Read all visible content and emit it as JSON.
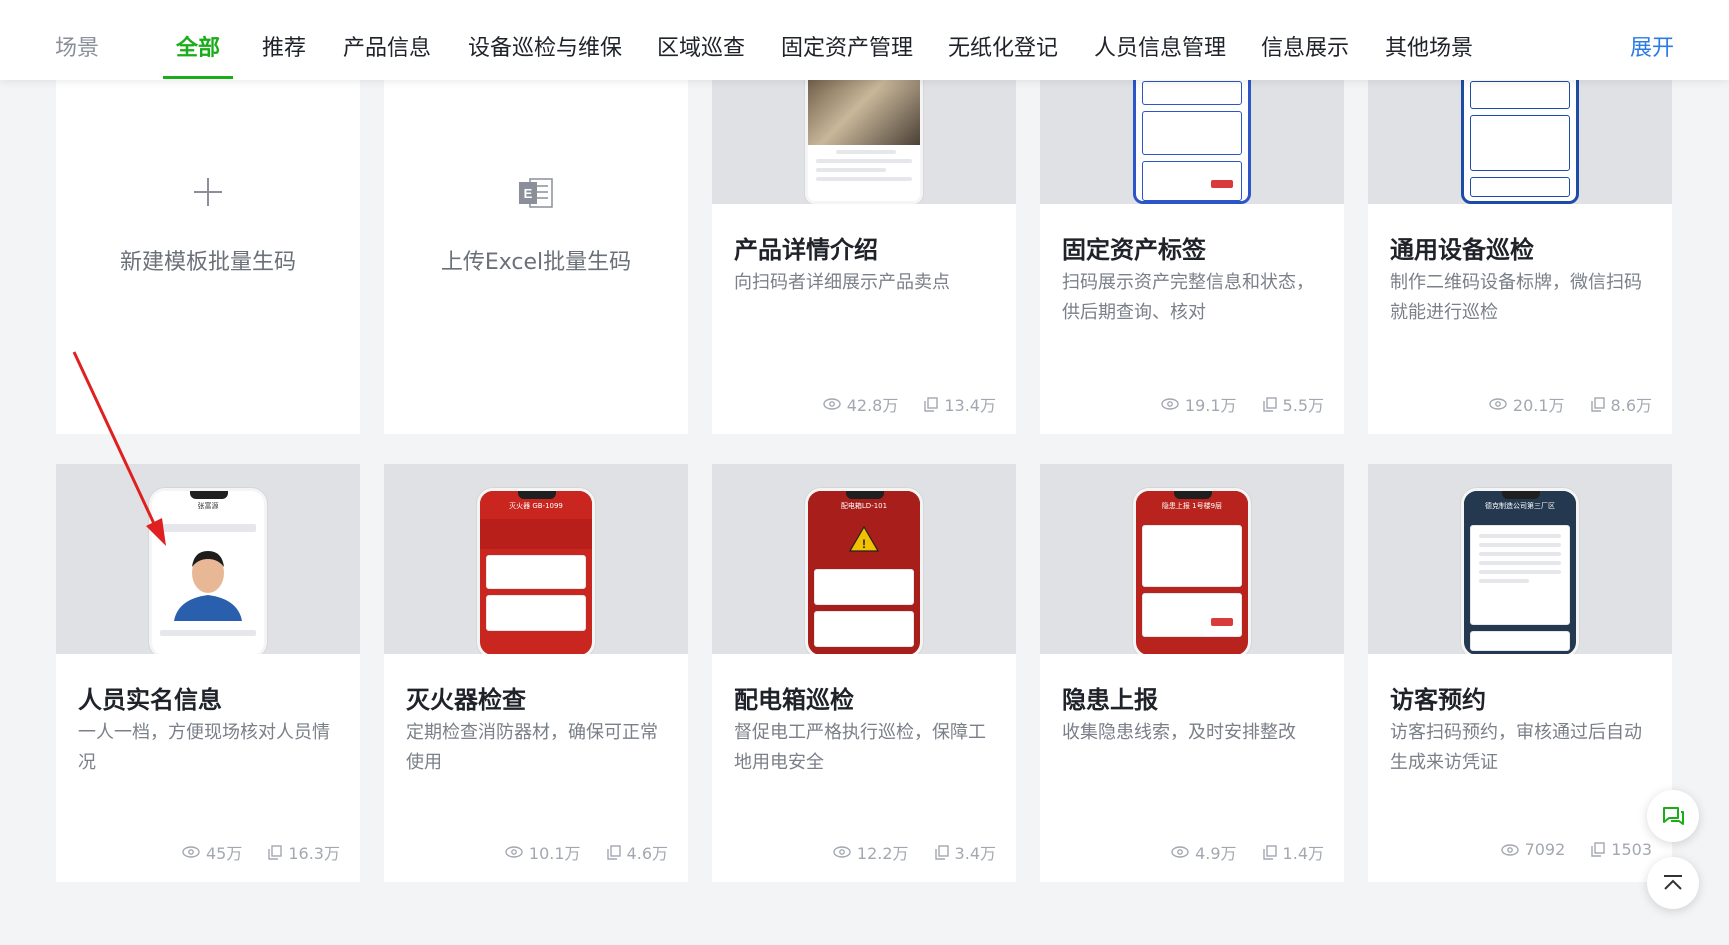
{
  "nav": {
    "label": "场景",
    "tabs": [
      {
        "label": "全部"
      },
      {
        "label": "推荐"
      },
      {
        "label": "产品信息"
      },
      {
        "label": "设备巡检与维保"
      },
      {
        "label": "区域巡查"
      },
      {
        "label": "固定资产管理"
      },
      {
        "label": "无纸化登记"
      },
      {
        "label": "人员信息管理"
      },
      {
        "label": "信息展示"
      },
      {
        "label": "其他场景"
      }
    ],
    "active_tab": "全部",
    "expand_label": "展开",
    "accent_color": "#1aad19"
  },
  "create_cards": [
    {
      "label": "新建模板批量生码",
      "icon": "plus-icon"
    },
    {
      "label": "上传Excel批量生码",
      "icon": "excel-file-icon"
    }
  ],
  "row1": [
    {
      "title": "产品详情介绍",
      "desc": "向扫码者详细展示产品卖点",
      "views": "42.8万",
      "copies": "13.4万"
    },
    {
      "title": "固定资产标签",
      "desc": "扫码展示资产完整信息和状态，供后期查询、核对",
      "views": "19.1万",
      "copies": "5.5万"
    },
    {
      "title": "通用设备巡检",
      "desc": "制作二维码设备标牌，微信扫码就能进行巡检",
      "views": "20.1万",
      "copies": "8.6万"
    }
  ],
  "row2": [
    {
      "title": "人员实名信息",
      "desc": "一人一档，方便现场核对人员情况",
      "views": "45万",
      "copies": "16.3万",
      "phone_title": "张富源"
    },
    {
      "title": "灭火器检查",
      "desc": "定期检查消防器材，确保可正常使用",
      "views": "10.1万",
      "copies": "4.6万",
      "phone_title": "灭火器 GB-1099"
    },
    {
      "title": "配电箱巡检",
      "desc": "督促电工严格执行巡检，保障工地用电安全",
      "views": "12.2万",
      "copies": "3.4万",
      "phone_title": "配电箱LD-101"
    },
    {
      "title": "隐患上报",
      "desc": "收集隐患线索，及时安排整改",
      "views": "4.9万",
      "copies": "1.4万",
      "phone_title": "隐患上报 1号楼9层"
    },
    {
      "title": "访客预约",
      "desc": "访客扫码预约，审核通过后自动生成来访凭证",
      "views": "7092",
      "copies": "1503",
      "phone_title": "德克制造公司第三厂区"
    }
  ],
  "icons": {
    "views": "eye-icon",
    "copies": "copy-icon",
    "chat": "chat-icon",
    "top": "back-to-top-icon"
  }
}
